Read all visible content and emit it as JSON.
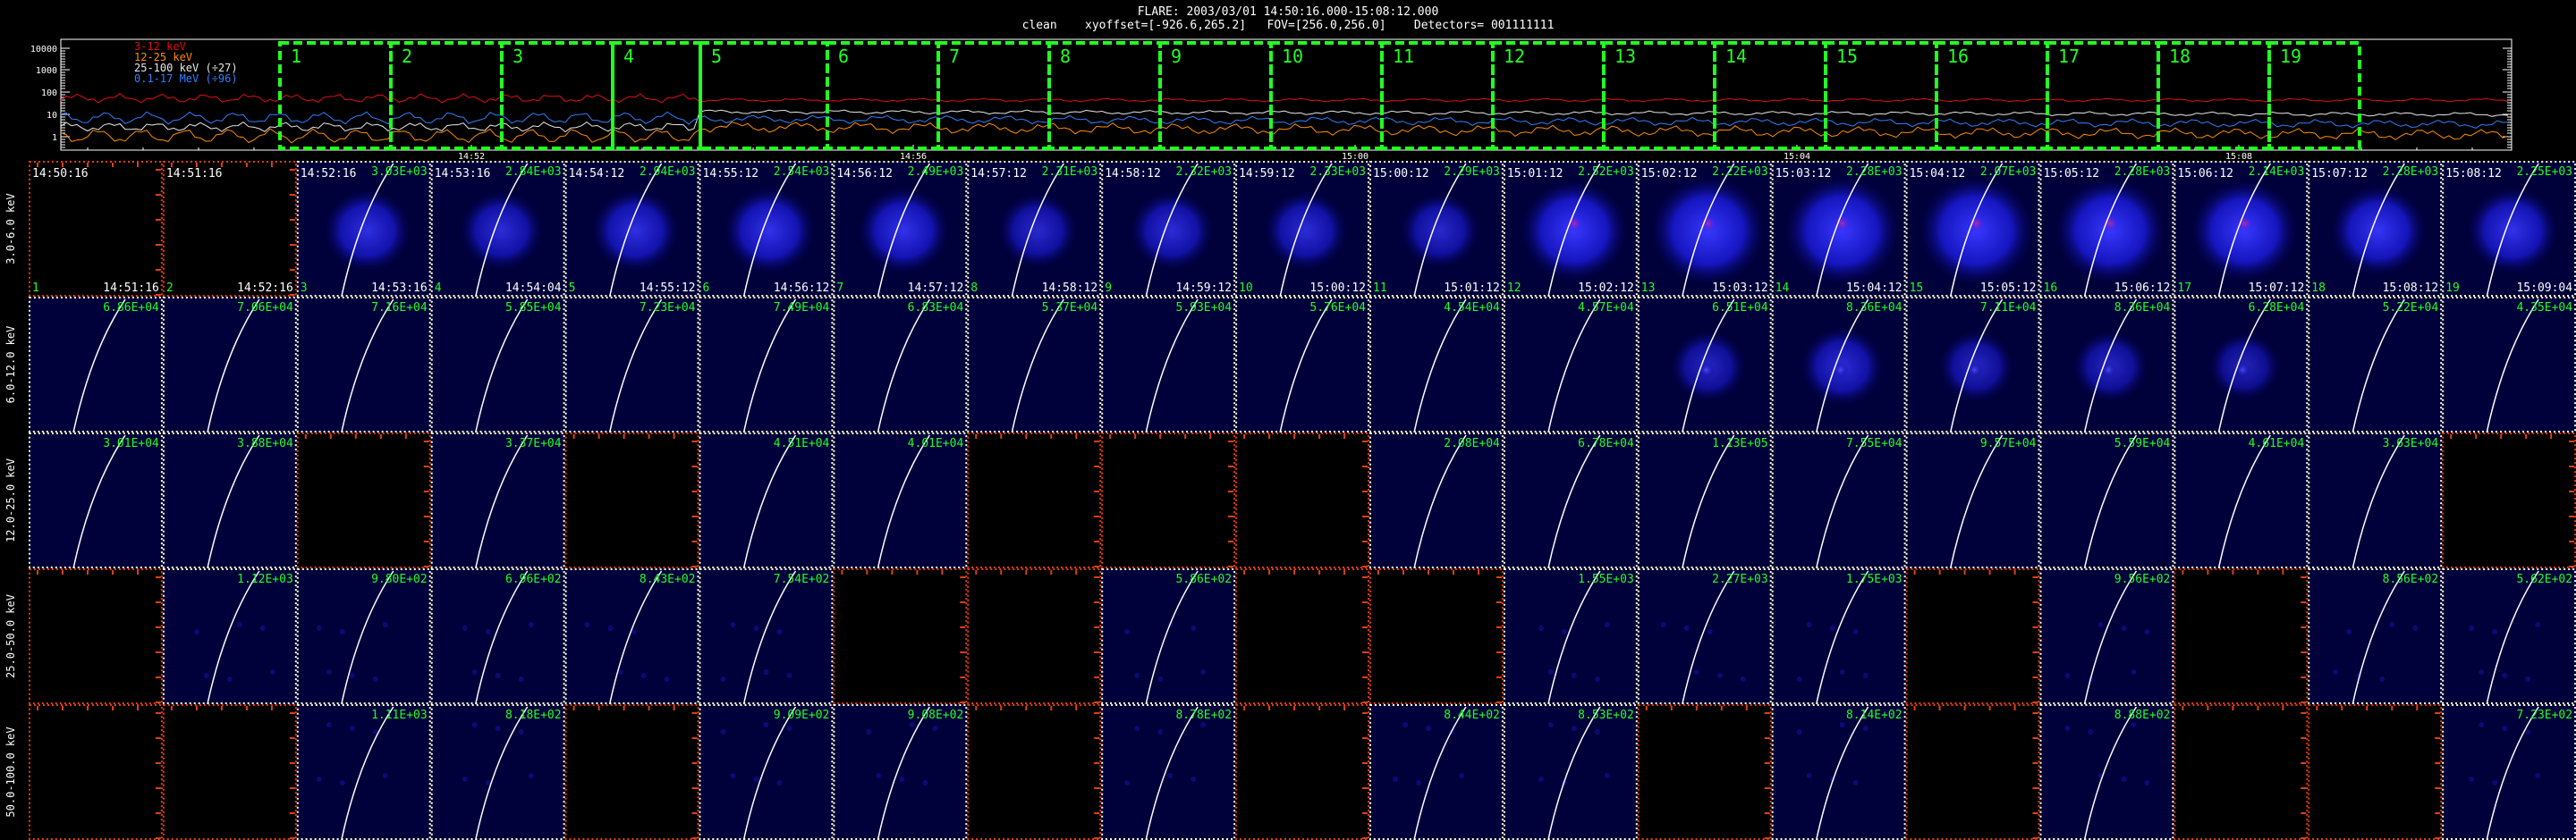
{
  "header": {
    "line1": "FLARE: 2003/03/01 14:50:16.000-15:08:12.000",
    "line2": "clean    xyoffset=[-926.6,265.2]   FOV=[256.0,256.0]    Detectors= 001111111"
  },
  "lightcurve": {
    "y_ticks": [
      "10000",
      "1000",
      "100",
      "10",
      "1"
    ],
    "x_ticks": [
      "14:52",
      "14:56",
      "15:00",
      "15:04",
      "15:08"
    ],
    "legend": [
      {
        "label": "3-12 keV",
        "color": "#e01010"
      },
      {
        "label": "12-25 keV",
        "color": "#ff8c00"
      },
      {
        "label": "25-100 keV (÷27)",
        "color": "#e8e8e8"
      },
      {
        "label": "0.1-17 MeV (÷96)",
        "color": "#2f7fff"
      }
    ],
    "intervals": [
      "1",
      "2",
      "3",
      "4",
      "5",
      "6",
      "7",
      "8",
      "9",
      "10",
      "11",
      "12",
      "13",
      "14",
      "15",
      "16",
      "17",
      "18",
      "19"
    ],
    "interval_color": "#22ff22"
  },
  "rows": [
    {
      "label": "3.0-6.0 keV",
      "cells": [
        {
          "empty": true,
          "t": "14:50:16",
          "te": "14:51:16",
          "n": "1"
        },
        {
          "empty": true,
          "t": "14:51:16",
          "te": "14:52:16",
          "n": "2"
        },
        {
          "v": "3.03E+03",
          "t": "14:52:16",
          "te": "14:53:16",
          "n": "3",
          "i": 0.45
        },
        {
          "v": "2.84E+03",
          "t": "14:53:16",
          "te": "14:54:04",
          "n": "4",
          "i": 0.4
        },
        {
          "v": "2.94E+03",
          "t": "14:54:12",
          "te": "14:55:12",
          "n": "5",
          "i": 0.45
        },
        {
          "v": "2.54E+03",
          "t": "14:55:12",
          "te": "14:56:12",
          "n": "6",
          "i": 0.5
        },
        {
          "v": "2.49E+03",
          "t": "14:56:12",
          "te": "14:57:12",
          "n": "7",
          "i": 0.5
        },
        {
          "v": "2.31E+03",
          "t": "14:57:12",
          "te": "14:58:12",
          "n": "8",
          "i": 0.35
        },
        {
          "v": "2.32E+03",
          "t": "14:58:12",
          "te": "14:59:12",
          "n": "9",
          "i": 0.4
        },
        {
          "v": "2.33E+03",
          "t": "14:59:12",
          "te": "15:00:12",
          "n": "10",
          "i": 0.4
        },
        {
          "v": "2.29E+03",
          "t": "15:00:12",
          "te": "15:01:12",
          "n": "11",
          "i": 0.35
        },
        {
          "v": "2.52E+03",
          "t": "15:01:12",
          "te": "15:02:12",
          "n": "12",
          "i": 0.7
        },
        {
          "v": "2.22E+03",
          "t": "15:02:12",
          "te": "15:03:12",
          "n": "13",
          "i": 0.8
        },
        {
          "v": "2.28E+03",
          "t": "15:03:12",
          "te": "15:04:12",
          "n": "14",
          "i": 0.8
        },
        {
          "v": "2.07E+03",
          "t": "15:04:12",
          "te": "15:05:12",
          "n": "15",
          "i": 0.8
        },
        {
          "v": "2.28E+03",
          "t": "15:05:12",
          "te": "15:06:12",
          "n": "16",
          "i": 0.75
        },
        {
          "v": "2.14E+03",
          "t": "15:06:12",
          "te": "15:07:12",
          "n": "17",
          "i": 0.7
        },
        {
          "v": "2.28E+03",
          "t": "15:07:12",
          "te": "15:08:12",
          "n": "18",
          "i": 0.55
        },
        {
          "v": "2.25E+03",
          "t": "15:08:12",
          "te": "15:09:04",
          "n": "19",
          "i": 0.5
        }
      ]
    },
    {
      "label": "6.0-12.0 keV",
      "cells": [
        {
          "v": "6.86E+04"
        },
        {
          "v": "7.06E+04"
        },
        {
          "v": "7.16E+04"
        },
        {
          "v": "5.85E+04"
        },
        {
          "v": "7.23E+04"
        },
        {
          "v": "7.49E+04"
        },
        {
          "v": "6.83E+04"
        },
        {
          "v": "5.37E+04"
        },
        {
          "v": "5.93E+04"
        },
        {
          "v": "5.76E+04"
        },
        {
          "v": "4.54E+04"
        },
        {
          "v": "4.57E+04"
        },
        {
          "v": "6.51E+04",
          "i": 0.3
        },
        {
          "v": "8.36E+04",
          "i": 0.4
        },
        {
          "v": "7.11E+04",
          "i": 0.3
        },
        {
          "v": "8.36E+04",
          "i": 0.3
        },
        {
          "v": "6.28E+04",
          "i": 0.25
        },
        {
          "v": "5.22E+04"
        },
        {
          "v": "4.35E+04"
        }
      ]
    },
    {
      "label": "12.0-25.0 keV",
      "cells": [
        {
          "v": "3.01E+04"
        },
        {
          "v": "3.88E+04"
        },
        {
          "empty": true
        },
        {
          "v": "3.37E+04"
        },
        {
          "empty": true
        },
        {
          "v": "4.51E+04"
        },
        {
          "v": "4.01E+04"
        },
        {
          "empty": true
        },
        {
          "empty": true
        },
        {
          "empty": true
        },
        {
          "v": "2.08E+04"
        },
        {
          "v": "6.78E+04"
        },
        {
          "v": "1.13E+05"
        },
        {
          "v": "7.55E+04"
        },
        {
          "v": "9.57E+04"
        },
        {
          "v": "5.59E+04"
        },
        {
          "v": "4.61E+04"
        },
        {
          "v": "3.63E+04"
        },
        {
          "empty": true
        }
      ]
    },
    {
      "label": "25.0-50.0 keV",
      "cells": [
        {
          "empty": true
        },
        {
          "v": "1.12E+03"
        },
        {
          "v": "9.80E+02"
        },
        {
          "v": "6.96E+02"
        },
        {
          "v": "8.43E+02"
        },
        {
          "v": "7.54E+02"
        },
        {
          "empty": true
        },
        {
          "empty": true
        },
        {
          "v": "5.86E+02"
        },
        {
          "empty": true
        },
        {
          "empty": true
        },
        {
          "v": "1.55E+03"
        },
        {
          "v": "2.27E+03"
        },
        {
          "v": "1.75E+03"
        },
        {
          "empty": true
        },
        {
          "v": "9.56E+02"
        },
        {
          "empty": true
        },
        {
          "v": "8.56E+02"
        },
        {
          "v": "5.62E+02"
        }
      ]
    },
    {
      "label": "50.0-100.0 keV",
      "cells": [
        {
          "empty": true
        },
        {
          "empty": true
        },
        {
          "v": "1.11E+03"
        },
        {
          "v": "8.18E+02"
        },
        {
          "empty": true
        },
        {
          "v": "9.09E+02"
        },
        {
          "v": "9.08E+02"
        },
        {
          "empty": true
        },
        {
          "v": "8.78E+02"
        },
        {
          "empty": true
        },
        {
          "v": "8.44E+02"
        },
        {
          "v": "8.53E+02"
        },
        {
          "empty": true
        },
        {
          "v": "8.14E+02"
        },
        {
          "empty": true
        },
        {
          "v": "8.88E+02"
        },
        {
          "empty": true
        },
        {
          "empty": true
        },
        {
          "v": "7.23E+02"
        }
      ]
    }
  ]
}
